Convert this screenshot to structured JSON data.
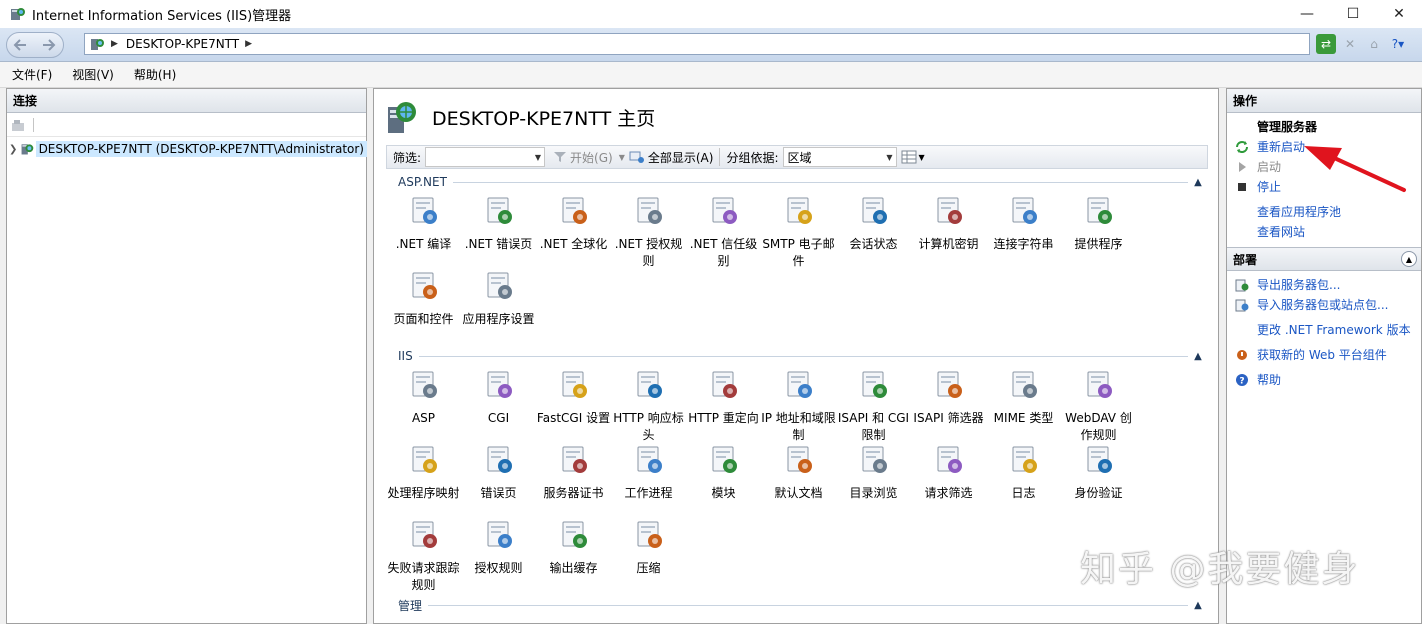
{
  "window": {
    "title": "Internet Information Services (IIS)管理器",
    "controls": [
      "—",
      "☐",
      "✕"
    ]
  },
  "address": {
    "host": "DESKTOP-KPE7NTT"
  },
  "menu": [
    "文件(F)",
    "视图(V)",
    "帮助(H)"
  ],
  "left": {
    "title": "连接",
    "tree_node": "DESKTOP-KPE7NTT (DESKTOP-KPE7NTT\\Administrator)"
  },
  "center": {
    "title": "DESKTOP-KPE7NTT 主页",
    "filter_label": "筛选:",
    "filter_value": "",
    "start_label": "开始(G)",
    "showall_label": "全部显示(A)",
    "group_label": "分组依据:",
    "group_value": "区域",
    "groups": [
      {
        "name": "ASP.NET",
        "items": [
          {
            "label": ".NET 编译",
            "icon": "net-compile-icon"
          },
          {
            "label": ".NET 错误页",
            "icon": "net-error-pages-icon"
          },
          {
            "label": ".NET 全球化",
            "icon": "net-globalization-icon"
          },
          {
            "label": ".NET 授权规则",
            "icon": "net-authorization-icon"
          },
          {
            "label": ".NET 信任级别",
            "icon": "net-trust-levels-icon"
          },
          {
            "label": "SMTP 电子邮件",
            "icon": "smtp-email-icon"
          },
          {
            "label": "会话状态",
            "icon": "session-state-icon"
          },
          {
            "label": "计算机密钥",
            "icon": "machine-key-icon"
          },
          {
            "label": "连接字符串",
            "icon": "connection-strings-icon"
          },
          {
            "label": "提供程序",
            "icon": "providers-icon"
          },
          {
            "label": "页面和控件",
            "icon": "pages-controls-icon"
          },
          {
            "label": "应用程序设置",
            "icon": "app-settings-icon"
          }
        ]
      },
      {
        "name": "IIS",
        "items": [
          {
            "label": "ASP",
            "icon": "asp-icon"
          },
          {
            "label": "CGI",
            "icon": "cgi-icon"
          },
          {
            "label": "FastCGI 设置",
            "icon": "fastcgi-icon"
          },
          {
            "label": "HTTP 响应标头",
            "icon": "http-response-headers-icon"
          },
          {
            "label": "HTTP 重定向",
            "icon": "http-redirect-icon"
          },
          {
            "label": "IP 地址和域限制",
            "icon": "ip-restrictions-icon"
          },
          {
            "label": "ISAPI 和 CGI 限制",
            "icon": "isapi-cgi-restrictions-icon"
          },
          {
            "label": "ISAPI 筛选器",
            "icon": "isapi-filters-icon"
          },
          {
            "label": "MIME 类型",
            "icon": "mime-types-icon"
          },
          {
            "label": "WebDAV 创作规则",
            "icon": "webdav-icon"
          },
          {
            "label": "处理程序映射",
            "icon": "handler-mappings-icon"
          },
          {
            "label": "错误页",
            "icon": "error-pages-icon"
          },
          {
            "label": "服务器证书",
            "icon": "server-certificates-icon"
          },
          {
            "label": "工作进程",
            "icon": "worker-processes-icon"
          },
          {
            "label": "模块",
            "icon": "modules-icon"
          },
          {
            "label": "默认文档",
            "icon": "default-document-icon"
          },
          {
            "label": "目录浏览",
            "icon": "directory-browsing-icon"
          },
          {
            "label": "请求筛选",
            "icon": "request-filtering-icon"
          },
          {
            "label": "日志",
            "icon": "logging-icon"
          },
          {
            "label": "身份验证",
            "icon": "authentication-icon"
          },
          {
            "label": "失败请求跟踪规则",
            "icon": "failed-request-tracing-icon"
          },
          {
            "label": "授权规则",
            "icon": "authorization-rules-icon"
          },
          {
            "label": "输出缓存",
            "icon": "output-caching-icon"
          },
          {
            "label": "压缩",
            "icon": "compression-icon"
          }
        ]
      },
      {
        "name": "管理",
        "items": []
      }
    ]
  },
  "right": {
    "title": "操作",
    "manage_header": "管理服务器",
    "actions": [
      {
        "label": "重新启动",
        "disabled": false,
        "icon": "restart-icon"
      },
      {
        "label": "启动",
        "disabled": true,
        "icon": "start-icon"
      },
      {
        "label": "停止",
        "disabled": false,
        "icon": "stop-icon"
      }
    ],
    "links": [
      "查看应用程序池",
      "查看网站"
    ],
    "deploy_title": "部署",
    "deploy": [
      {
        "label": "导出服务器包...",
        "icon": "export-icon"
      },
      {
        "label": "导入服务器包或站点包...",
        "icon": "import-icon"
      },
      {
        "label": "更改 .NET Framework 版本",
        "icon": ""
      },
      {
        "label": "获取新的 Web 平台组件",
        "icon": "web-platform-icon"
      },
      {
        "label": "帮助",
        "icon": "help-icon"
      }
    ]
  },
  "watermark": "知乎 @我要健身",
  "colors": {
    "link": "#1a56c4",
    "highlight": "#cce8ff",
    "arrow": "#e0141e"
  }
}
